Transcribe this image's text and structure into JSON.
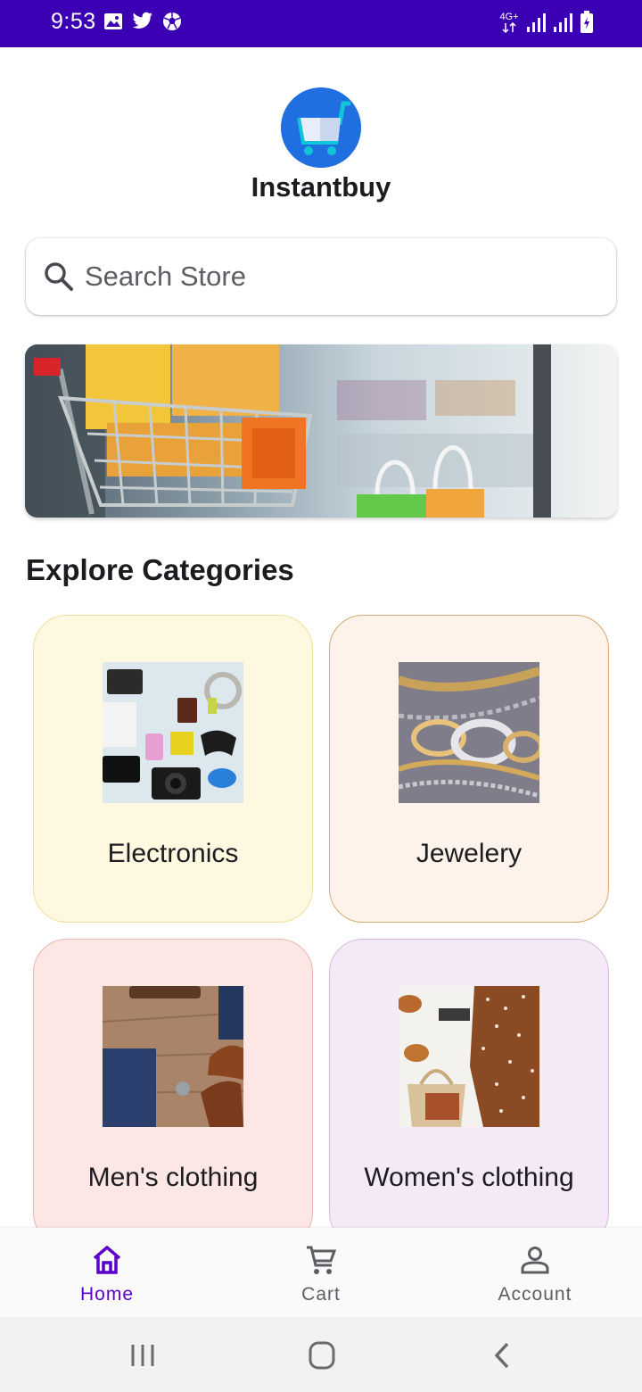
{
  "status_bar": {
    "time": "9:53",
    "network_label": "4G+",
    "left_icons": [
      "image-icon",
      "twitter-icon",
      "soccer-ball-icon"
    ],
    "right_icons": [
      "data-4g-icon",
      "signal-icon",
      "signal-icon",
      "battery-charging-icon"
    ],
    "background_color": "#3b00b3"
  },
  "header": {
    "app_name": "Instantbuy",
    "logo_icon": "shopping-cart-icon"
  },
  "search": {
    "placeholder": "Search Store",
    "value": ""
  },
  "section": {
    "title": "Explore Categories"
  },
  "categories": [
    {
      "label": "Electronics",
      "bg": "#fff8e1",
      "border": "#f1df9c"
    },
    {
      "label": "Jewelery",
      "bg": "#fdf3ea",
      "border": "#d9a86b"
    },
    {
      "label": "Men's clothing",
      "bg": "#fde7e4",
      "border": "#e9b6ad"
    },
    {
      "label": "Women's clothing",
      "bg": "#f4e9f7",
      "border": "#d6b8e0"
    }
  ],
  "bottom_nav": {
    "items": [
      {
        "label": "Home",
        "icon": "home-icon",
        "active": true
      },
      {
        "label": "Cart",
        "icon": "cart-icon",
        "active": false
      },
      {
        "label": "Account",
        "icon": "person-icon",
        "active": false
      }
    ],
    "active_color": "#5b00c9",
    "inactive_color": "#5f5c63"
  },
  "system_nav": {
    "buttons": [
      "recents-icon",
      "home-circle-icon",
      "back-icon"
    ]
  }
}
